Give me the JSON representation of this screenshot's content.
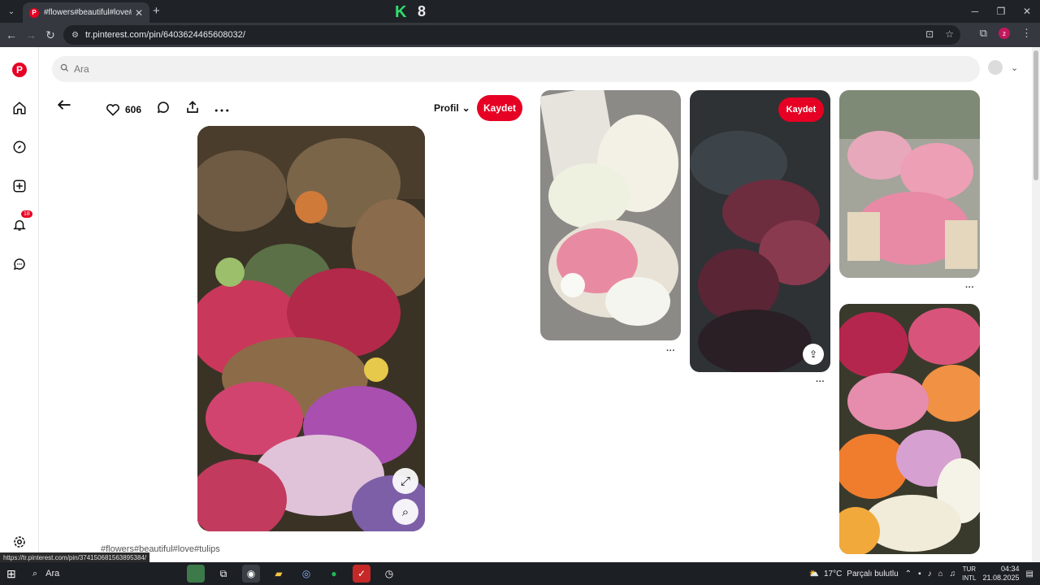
{
  "browser": {
    "tab_title": "#flowers#beautiful#love#tulips",
    "tab_favicon": "P",
    "new_tab": "+",
    "center_badge_letter": "K",
    "center_badge_count": "8",
    "url": "tr.pinterest.com/pin/6403624465608032/",
    "status_url": "https://tr.pinterest.com/pin/374150681563895384/"
  },
  "pinterest": {
    "search_placeholder": "Ara",
    "sidebar_badge": "18",
    "pin": {
      "like_count": "606",
      "profile_label": "Profil",
      "save_label": "Kaydet",
      "caption": "#flowers#beautiful#love#tulips"
    },
    "grid_save_label": "Kaydet",
    "more_dots": "···"
  },
  "taskbar": {
    "search_label": "Ara",
    "temperature": "17°C",
    "weather": "Parçalı bulutlu",
    "lang_top": "TUR",
    "lang_bottom": "INTL",
    "time": "04:34",
    "date": "21.08.2025"
  },
  "colors": {
    "pinterest_red": "#e60023",
    "chrome_dark": "#1f2328",
    "chrome_mid": "#35393f"
  }
}
